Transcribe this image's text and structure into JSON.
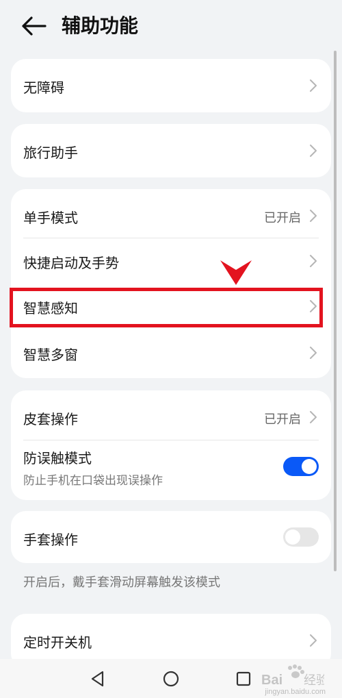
{
  "header": {
    "title": "辅助功能",
    "back_icon": "arrow-left-icon"
  },
  "groups": {
    "g1": {
      "items": [
        {
          "label": "无障碍"
        }
      ]
    },
    "g2": {
      "items": [
        {
          "label": "旅行助手"
        }
      ]
    },
    "g3": {
      "items": [
        {
          "label": "单手模式",
          "value": "已开启"
        },
        {
          "label": "快捷启动及手势"
        },
        {
          "label": "智慧感知"
        },
        {
          "label": "智慧多窗"
        }
      ]
    },
    "g4": {
      "items": [
        {
          "label": "皮套操作",
          "value": "已开启"
        },
        {
          "label": "防误触模式",
          "subtitle": "防止手机在口袋出现误操作",
          "toggle": "on"
        }
      ]
    },
    "g5": {
      "items": [
        {
          "label": "手套操作",
          "toggle": "off"
        }
      ],
      "note": "开启后，戴手套滑动屏幕触发该模式"
    },
    "g6": {
      "items": [
        {
          "label": "定时开关机"
        }
      ]
    }
  },
  "colors": {
    "accent": "#0a59f7",
    "highlight": "#e3131f",
    "toggle_off": "#e6e6e6"
  },
  "annotation": {
    "highlight_target": "智慧感知"
  },
  "navbar": {
    "icons": [
      "nav-back-icon",
      "nav-home-icon",
      "nav-recents-icon"
    ]
  },
  "watermark": {
    "text": "Bai经验",
    "url_text": "jingyan.baidu.com"
  }
}
